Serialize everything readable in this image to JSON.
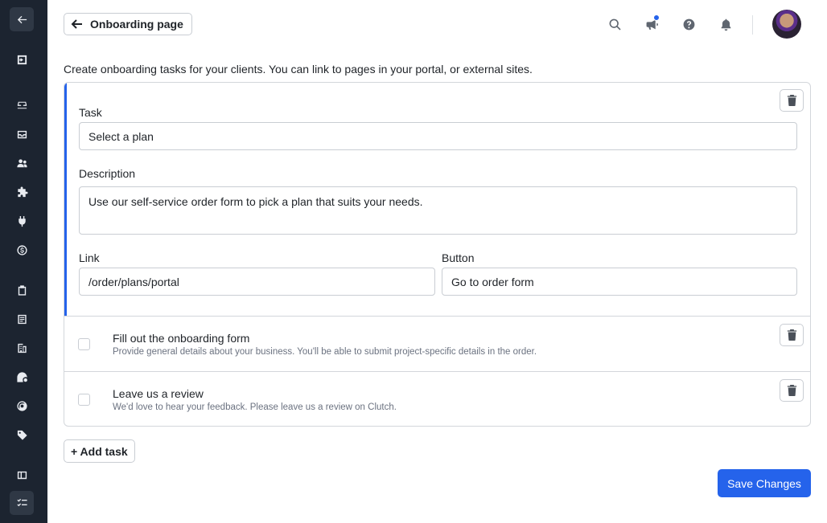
{
  "header": {
    "back_label": "Onboarding page"
  },
  "intro_text": "Create onboarding tasks for your clients. You can link to pages in your portal, or external sites.",
  "editor": {
    "task_label": "Task",
    "task_value": "Select a plan",
    "description_label": "Description",
    "description_value": "Use our self-service order form to pick a plan that suits your needs.",
    "link_label": "Link",
    "link_value": "/order/plans/portal",
    "button_label": "Button",
    "button_value": "Go to order form"
  },
  "tasks": [
    {
      "title": "Fill out the onboarding form",
      "description": "Provide general details about your business. You'll be able to submit project-specific details in the order."
    },
    {
      "title": "Leave us a review",
      "description": "We'd love to hear your feedback. Please leave us a review on Clutch."
    }
  ],
  "actions": {
    "add_task_label": "+ Add task",
    "save_label": "Save Changes"
  },
  "colors": {
    "sidebar": "#1c2430",
    "accent": "#2563eb"
  }
}
